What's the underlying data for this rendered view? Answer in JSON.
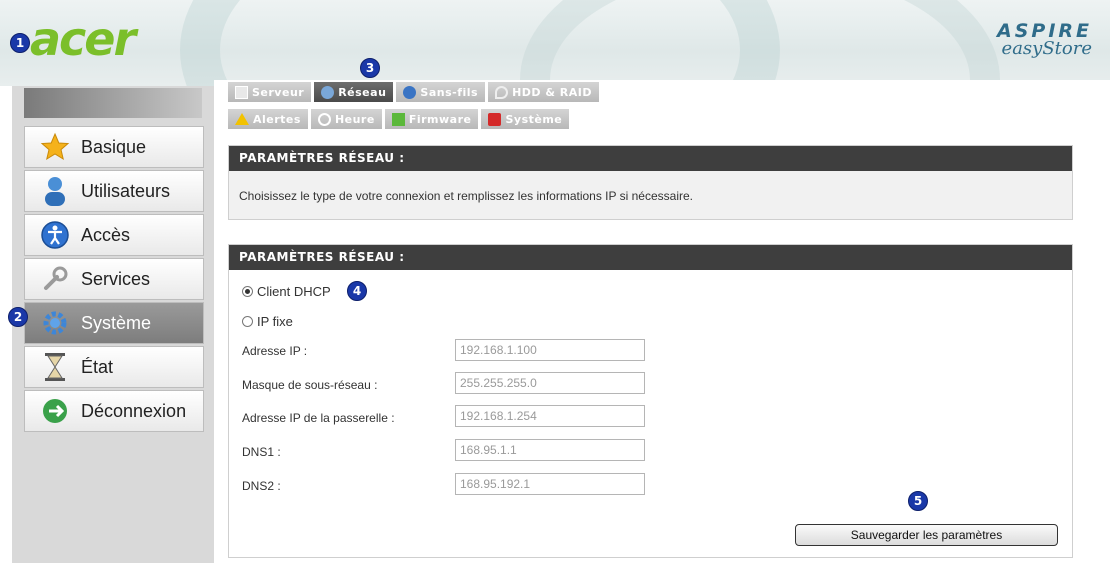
{
  "brand": {
    "logo": "acer",
    "product_line1": "ASPIRE",
    "product_line2": "easyStore"
  },
  "badges": [
    "1",
    "2",
    "3",
    "4",
    "5"
  ],
  "sidebar": {
    "items": [
      {
        "label": "Basique",
        "icon": "star-icon"
      },
      {
        "label": "Utilisateurs",
        "icon": "user-icon"
      },
      {
        "label": "Accès",
        "icon": "access-icon"
      },
      {
        "label": "Services",
        "icon": "wrench-icon"
      },
      {
        "label": "Système",
        "icon": "gear-icon",
        "active": true
      },
      {
        "label": "État",
        "icon": "hourglass-icon"
      },
      {
        "label": "Déconnexion",
        "icon": "logout-icon"
      }
    ]
  },
  "tabs": {
    "row1": [
      {
        "label": "Serveur",
        "icon": "server-icon"
      },
      {
        "label": "Réseau",
        "icon": "network-icon",
        "active": true
      },
      {
        "label": "Sans-fils",
        "icon": "globe-icon"
      },
      {
        "label": "HDD & RAID",
        "icon": "disk-icon"
      }
    ],
    "row2": [
      {
        "label": "Alertes",
        "icon": "warning-icon"
      },
      {
        "label": "Heure",
        "icon": "clock-icon"
      },
      {
        "label": "Firmware",
        "icon": "firmware-icon"
      },
      {
        "label": "Système",
        "icon": "power-icon"
      }
    ]
  },
  "panel1": {
    "title": "PARAMÈTRES RÉSEAU :",
    "description": "Choisissez le type de votre connexion et remplissez les informations IP si nécessaire."
  },
  "panel2": {
    "title": "PARAMÈTRES RÉSEAU :",
    "options": [
      {
        "label": "Client DHCP",
        "selected": true
      },
      {
        "label": "IP fixe",
        "selected": false
      }
    ],
    "fields": [
      {
        "label": "Adresse IP :",
        "value": "192.168.1.100"
      },
      {
        "label": "Masque de sous-réseau :",
        "value": "255.255.255.0"
      },
      {
        "label": "Adresse IP de la passerelle :",
        "value": "192.168.1.254"
      },
      {
        "label": "DNS1 :",
        "value": "168.95.1.1"
      },
      {
        "label": "DNS2 :",
        "value": "168.95.192.1"
      }
    ],
    "save_label": "Sauvegarder les paramètres"
  },
  "colors": {
    "accent": "#7bbf2a",
    "badge": "#1a38a8",
    "header_bar": "#3e3e3e"
  }
}
